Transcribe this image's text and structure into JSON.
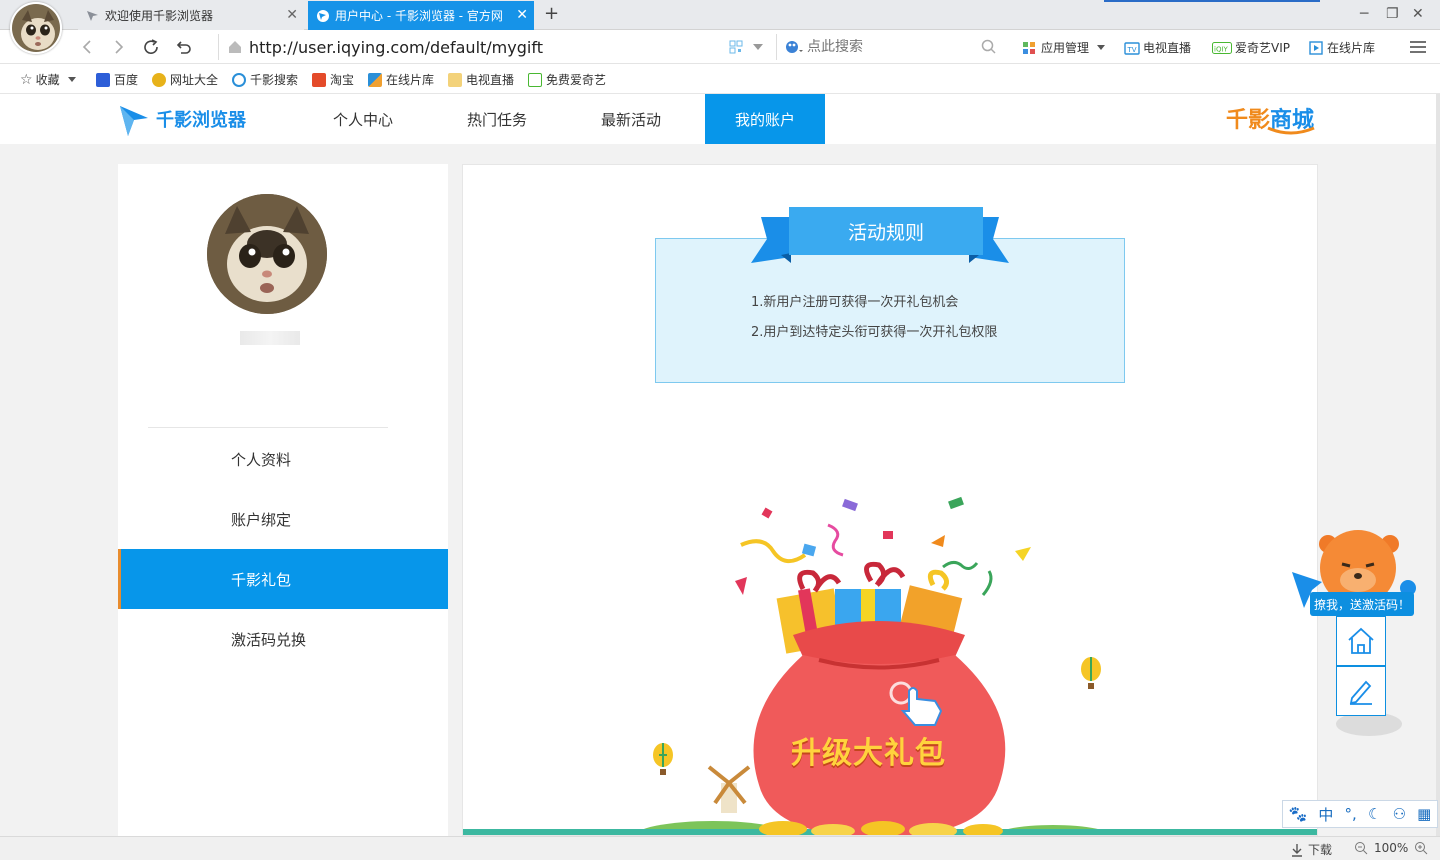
{
  "browser": {
    "tabs": [
      {
        "title": "欢迎使用千影浏览器",
        "active": false
      },
      {
        "title": "用户中心 - 千影浏览器 - 官方网",
        "active": true
      }
    ],
    "new_tab_label": "+",
    "window_controls": {
      "minimize": "─",
      "restore": "❐",
      "close": "✕"
    },
    "address": "http://user.iqying.com/default/mygift",
    "search_placeholder": "点此搜索",
    "toolbar_links": [
      "应用管理",
      "电视直播",
      "爱奇艺VIP",
      "在线片库"
    ],
    "bookmarks": [
      "收藏",
      "百度",
      "网址大全",
      "千影搜索",
      "淘宝",
      "在线片库",
      "电视直播",
      "免费爱奇艺"
    ]
  },
  "site": {
    "logo_text": "千影浏览器",
    "nav": [
      "个人中心",
      "热门任务",
      "最新活动",
      "我的账户"
    ],
    "active_nav": "我的账户",
    "mall_logo": {
      "part1": "千影",
      "part2": "商城"
    }
  },
  "sidebar": {
    "items": [
      "个人资料",
      "账户绑定",
      "千影礼包",
      "激活码兑换"
    ],
    "active_item": "千影礼包"
  },
  "rules": {
    "title": "活动规则",
    "lines": [
      "1.新用户注册可获得一次开礼包机会",
      "2.用户到达特定头衔可获得一次开礼包权限"
    ]
  },
  "gift": {
    "bag_text": "升级大礼包"
  },
  "floating": {
    "bubble_text": "撩我，送激活码！"
  },
  "ime": {
    "lang": "中",
    "punct": "°,"
  },
  "statusbar": {
    "download": "下载",
    "zoom": "100%"
  },
  "colors": {
    "accent": "#0796ea",
    "tab_active": "#1693e8",
    "rules_bg": "#dff3fc",
    "active_border": "#e88c2e"
  }
}
